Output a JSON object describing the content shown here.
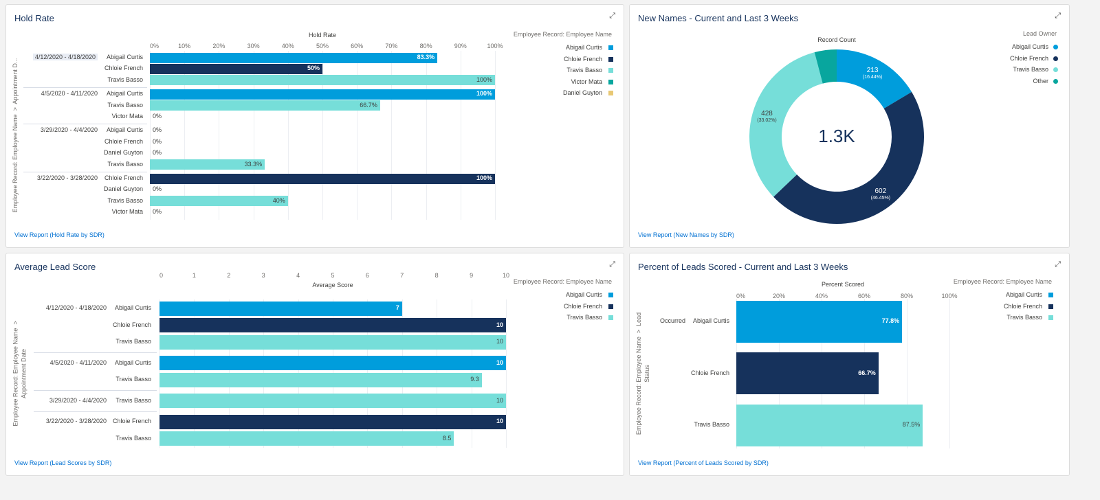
{
  "colors": {
    "Abigail Curtis": "#009ddc",
    "Chloie French": "#16325c",
    "Travis Basso": "#76ded9",
    "Victor Mata": "#08a69e",
    "Daniel Guyton": "#e8c874",
    "Other": "#08a69e"
  },
  "icons": {
    "expand": "expand-icon"
  },
  "chart_data": [
    {
      "id": "hold",
      "type": "bar",
      "orientation": "horizontal",
      "panel_title": "Hold Rate",
      "title": "Hold Rate",
      "ylabel": "Employee Record: Employee Name  >  Appointment D...",
      "xlim": [
        0,
        100
      ],
      "unit": "%",
      "ticks": [
        "0%",
        "10%",
        "20%",
        "30%",
        "40%",
        "50%",
        "60%",
        "70%",
        "80%",
        "90%",
        "100%"
      ],
      "tick_values": [
        0,
        10,
        20,
        30,
        40,
        50,
        60,
        70,
        80,
        90,
        100
      ],
      "grid": true,
      "legend_title": "Employee Record: Employee Name",
      "legend": [
        "Abigail Curtis",
        "Chloie French",
        "Travis Basso",
        "Victor Mata",
        "Daniel Guyton"
      ],
      "legend_placement": "right",
      "groups": [
        {
          "label": "4/12/2020 - 4/18/2020",
          "rows": [
            {
              "name": "Abigail Curtis",
              "value": 83.3,
              "label": "83.3%"
            },
            {
              "name": "Chloie French",
              "value": 50,
              "label": "50%"
            },
            {
              "name": "Travis Basso",
              "value": 100,
              "label": "100%"
            }
          ]
        },
        {
          "label": "4/5/2020 - 4/11/2020",
          "rows": [
            {
              "name": "Abigail Curtis",
              "value": 100,
              "label": "100%"
            },
            {
              "name": "Travis Basso",
              "value": 66.7,
              "label": "66.7%"
            },
            {
              "name": "Victor Mata",
              "value": 0,
              "label": "0%"
            }
          ]
        },
        {
          "label": "3/29/2020 - 4/4/2020",
          "rows": [
            {
              "name": "Abigail Curtis",
              "value": 0,
              "label": "0%"
            },
            {
              "name": "Chloie French",
              "value": 0,
              "label": "0%"
            },
            {
              "name": "Daniel Guyton",
              "value": 0,
              "label": "0%"
            },
            {
              "name": "Travis Basso",
              "value": 33.3,
              "label": "33.3%"
            }
          ]
        },
        {
          "label": "3/22/2020 - 3/28/2020",
          "rows": [
            {
              "name": "Chloie French",
              "value": 100,
              "label": "100%"
            },
            {
              "name": "Daniel Guyton",
              "value": 0,
              "label": "0%"
            },
            {
              "name": "Travis Basso",
              "value": 40,
              "label": "40%"
            },
            {
              "name": "Victor Mata",
              "value": 0,
              "label": "0%"
            }
          ]
        }
      ],
      "link": "View Report (Hold Rate by SDR)"
    },
    {
      "id": "names",
      "type": "pie",
      "donut": true,
      "panel_title": "New Names - Current and Last 3 Weeks",
      "title": "Record Count",
      "center_label": "1.3K",
      "legend_title": "Lead Owner",
      "legend": [
        "Abigail Curtis",
        "Chloie French",
        "Travis Basso",
        "Other"
      ],
      "legend_placement": "right",
      "slices": [
        {
          "name": "Abigail Curtis",
          "value": 213,
          "label": "213",
          "pct": "(16.44%)"
        },
        {
          "name": "Chloie French",
          "value": 602,
          "label": "602",
          "pct": "(46.45%)"
        },
        {
          "name": "Travis Basso",
          "value": 428,
          "label": "428",
          "pct": "(33.02%)"
        },
        {
          "name": "Other",
          "value": 53,
          "label": "",
          "pct": ""
        }
      ],
      "link": "View Report (New Names by SDR)"
    },
    {
      "id": "avg",
      "type": "bar",
      "orientation": "horizontal",
      "panel_title": "Average Lead Score",
      "title": "Average Score",
      "ylabel": "Employee Record: Employee Name  >\nAppointment Date",
      "xlim": [
        0,
        10
      ],
      "unit": "",
      "ticks": [
        "0",
        "1",
        "2",
        "3",
        "4",
        "5",
        "6",
        "7",
        "8",
        "9",
        "10"
      ],
      "tick_values": [
        0,
        1,
        2,
        3,
        4,
        5,
        6,
        7,
        8,
        9,
        10
      ],
      "grid": true,
      "legend_title": "Employee Record: Employee Name",
      "legend": [
        "Abigail Curtis",
        "Chloie French",
        "Travis Basso"
      ],
      "legend_placement": "right",
      "groups": [
        {
          "label": "4/12/2020 - 4/18/2020",
          "rows": [
            {
              "name": "Abigail Curtis",
              "value": 7,
              "label": "7"
            },
            {
              "name": "Chloie French",
              "value": 10,
              "label": "10"
            },
            {
              "name": "Travis Basso",
              "value": 10,
              "label": "10"
            }
          ]
        },
        {
          "label": "4/5/2020 - 4/11/2020",
          "rows": [
            {
              "name": "Abigail Curtis",
              "value": 10,
              "label": "10"
            },
            {
              "name": "Travis Basso",
              "value": 9.3,
              "label": "9.3"
            }
          ]
        },
        {
          "label": "3/29/2020 - 4/4/2020",
          "rows": [
            {
              "name": "Travis Basso",
              "value": 10,
              "label": "10"
            }
          ]
        },
        {
          "label": "3/22/2020 - 3/28/2020",
          "rows": [
            {
              "name": "Chloie French",
              "value": 10,
              "label": "10"
            },
            {
              "name": "Travis Basso",
              "value": 8.5,
              "label": "8.5"
            }
          ]
        }
      ],
      "link": "View Report (Lead Scores by SDR)"
    },
    {
      "id": "pct",
      "type": "bar",
      "orientation": "horizontal",
      "panel_title": "Percent of Leads Scored - Current and Last 3 Weeks",
      "title": "Percent Scored",
      "ylabel": "Employee Record: Employee Name  >  Lead\nStatus",
      "xlim": [
        0,
        100
      ],
      "unit": "%",
      "ticks": [
        "0%",
        "20%",
        "40%",
        "60%",
        "80%",
        "100%"
      ],
      "tick_values": [
        0,
        20,
        40,
        60,
        80,
        100
      ],
      "grid": true,
      "legend_title": "Employee Record: Employee Name",
      "legend": [
        "Abigail Curtis",
        "Chloie French",
        "Travis Basso"
      ],
      "legend_placement": "right",
      "groups": [
        {
          "label": "Occurred",
          "rows": [
            {
              "name": "Abigail Curtis",
              "value": 77.8,
              "label": "77.8%"
            },
            {
              "name": "Chloie French",
              "value": 66.7,
              "label": "66.7%"
            },
            {
              "name": "Travis Basso",
              "value": 87.5,
              "label": "87.5%"
            }
          ]
        }
      ],
      "link": "View Report (Percent of Leads Scored by SDR)"
    }
  ]
}
